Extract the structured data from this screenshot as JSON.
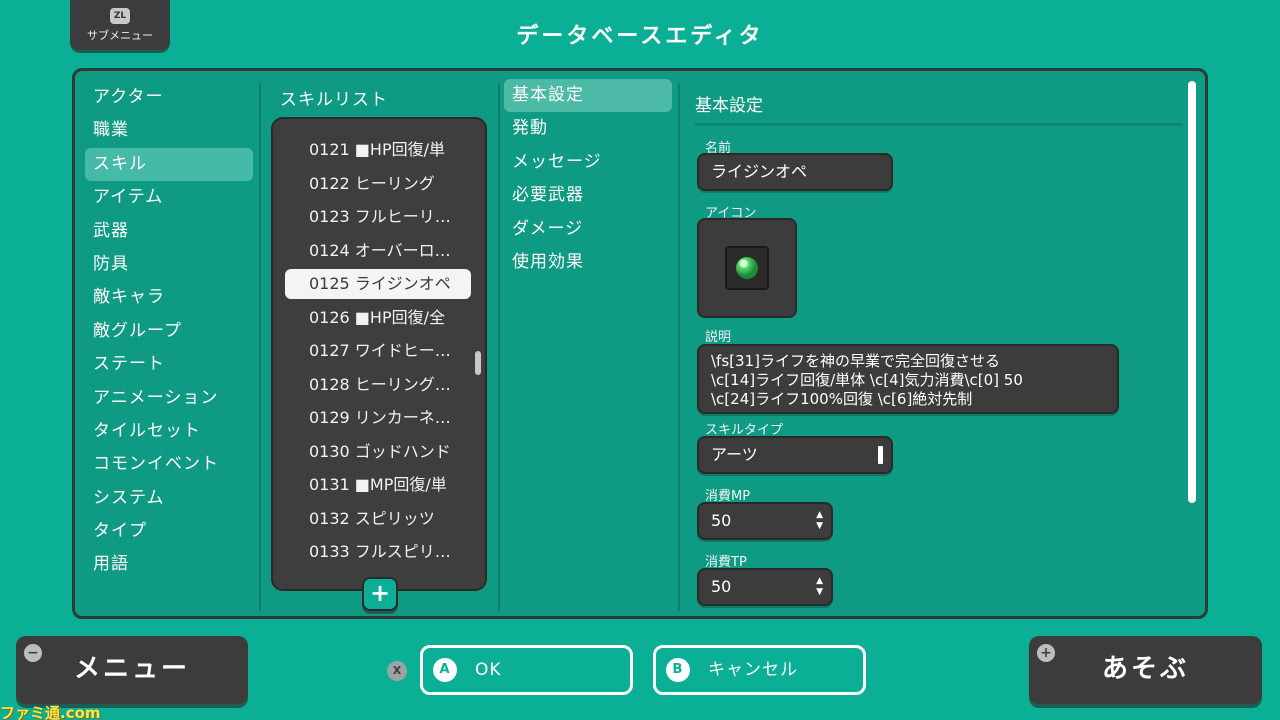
{
  "header": {
    "title": "データベースエディタ",
    "submenu_badge": "ZL",
    "submenu_label": "サブメニュー"
  },
  "categories": [
    {
      "label": "アクター"
    },
    {
      "label": "職業"
    },
    {
      "label": "スキル",
      "active": true
    },
    {
      "label": "アイテム"
    },
    {
      "label": "武器"
    },
    {
      "label": "防具"
    },
    {
      "label": "敵キャラ"
    },
    {
      "label": "敵グループ"
    },
    {
      "label": "ステート"
    },
    {
      "label": "アニメーション"
    },
    {
      "label": "タイルセット"
    },
    {
      "label": "コモンイベント"
    },
    {
      "label": "システム"
    },
    {
      "label": "タイプ"
    },
    {
      "label": "用語"
    }
  ],
  "skill_list": {
    "header": "スキルリスト",
    "items": [
      {
        "label": "0121 ■HP回復/単"
      },
      {
        "label": "0122 ヒーリング"
      },
      {
        "label": "0123 フルヒーリ…"
      },
      {
        "label": "0124 オーバーロ…"
      },
      {
        "label": "0125 ライジンオペ",
        "active": true
      },
      {
        "label": "0126 ■HP回復/全"
      },
      {
        "label": "0127 ワイドヒー…"
      },
      {
        "label": "0128 ヒーリング…"
      },
      {
        "label": "0129 リンカーネ…"
      },
      {
        "label": "0130 ゴッドハンド"
      },
      {
        "label": "0131 ■MP回復/単"
      },
      {
        "label": "0132 スピリッツ"
      },
      {
        "label": "0133 フルスピリ…"
      }
    ],
    "add_label": "+"
  },
  "tabs": [
    {
      "label": "基本設定",
      "active": true
    },
    {
      "label": "発動"
    },
    {
      "label": "メッセージ"
    },
    {
      "label": "必要武器"
    },
    {
      "label": "ダメージ"
    },
    {
      "label": "使用効果"
    }
  ],
  "detail": {
    "title": "基本設定",
    "name_label": "名前",
    "name_value": "ライジンオペ",
    "icon_label": "アイコン",
    "icon_name": "green-orb-icon",
    "desc_label": "説明",
    "desc_lines": [
      "\\fs[31]ライフを神の早業で完全回復させる",
      "\\c[14]ライフ回復/単体 \\c[4]気力消費\\c[0] 50",
      "\\c[24]ライフ100%回復 \\c[6]絶対先制"
    ],
    "skilltype_label": "スキルタイプ",
    "skilltype_value": "アーツ",
    "mp_label": "消費MP",
    "mp_value": "50",
    "tp_label": "消費TP",
    "tp_value": "50"
  },
  "footer": {
    "menu_label": "メニュー",
    "menu_badge": "−",
    "x_hint": "X",
    "ok_badge": "A",
    "ok_label": "OK",
    "cancel_badge": "B",
    "cancel_label": "キャンセル",
    "play_label": "あそぶ",
    "play_badge": "+"
  },
  "watermark": "ファミ通.com",
  "colors": {
    "background": "#0aaf96",
    "panel": "#0f9a83",
    "dark_box": "#3c3c3c",
    "highlight": "#45bba7"
  }
}
